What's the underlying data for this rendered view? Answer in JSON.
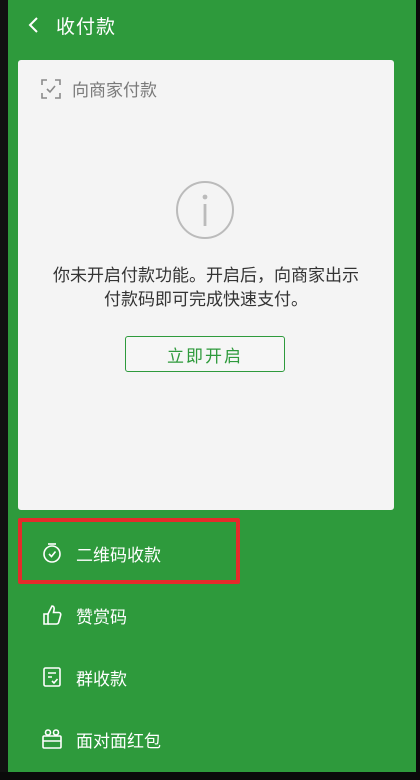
{
  "header": {
    "title": "收付款"
  },
  "payment_card": {
    "heading": "向商家付款",
    "message_line1": "你未开启付款功能。开启后，向商家出示",
    "message_line2": "付款码即可完成快速支付。",
    "enable_button": "立即开启"
  },
  "menu": {
    "items": [
      {
        "label": "二维码收款",
        "icon": "qr-receive-icon"
      },
      {
        "label": "赞赏码",
        "icon": "thumbs-up-icon"
      },
      {
        "label": "群收款",
        "icon": "group-receive-icon"
      },
      {
        "label": "面对面红包",
        "icon": "red-packet-icon"
      }
    ]
  },
  "colors": {
    "background": "#2e9a3c",
    "card": "#f4f4f4",
    "accent_green": "#2e9a3c",
    "highlight_red": "#e52b2b"
  }
}
